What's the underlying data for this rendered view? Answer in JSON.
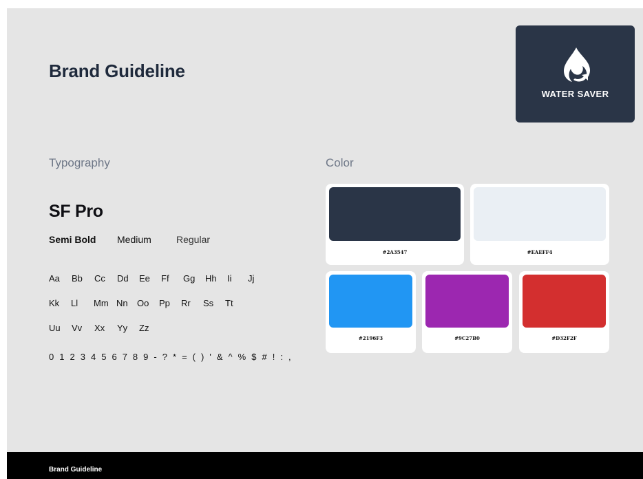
{
  "header": {
    "title": "Brand Guideline"
  },
  "logo": {
    "text": "WATER SAVER",
    "icon": "water-drop-icon",
    "background": "#2A3547"
  },
  "typography": {
    "section_label": "Typography",
    "font_name": "SF Pro",
    "weights": [
      "Semi Bold",
      "Medium",
      "Regular"
    ],
    "glyph_rows": [
      [
        "Aa",
        "Bb",
        "Cc",
        "Dd",
        "Ee",
        "Ff",
        "Gg",
        "Hh",
        "Ii",
        "Jj"
      ],
      [
        "Kk",
        "Ll",
        "Mm",
        "Nn",
        "Oo",
        "Pp",
        "Rr",
        "Ss",
        "Tt"
      ],
      [
        "Uu",
        "Vv",
        "Xx",
        "Yy",
        "Zz"
      ]
    ],
    "numerals": "0 1 2 3 4 5 6 7 8 9  - ? * = ( ) ' & ^ % $ # ! : ,"
  },
  "color": {
    "section_label": "Color",
    "swatches": [
      {
        "code": "#2A3547",
        "hex": "#2A3547"
      },
      {
        "code": "#EAEFF4",
        "hex": "#EAEFF4"
      },
      {
        "code": "#2196F3",
        "hex": "#2196F3"
      },
      {
        "code": "#9C27B0",
        "hex": "#9C27B0"
      },
      {
        "code": "#D32F2F",
        "hex": "#D32F2F"
      }
    ]
  },
  "footer": {
    "text": "Brand Guideline"
  }
}
